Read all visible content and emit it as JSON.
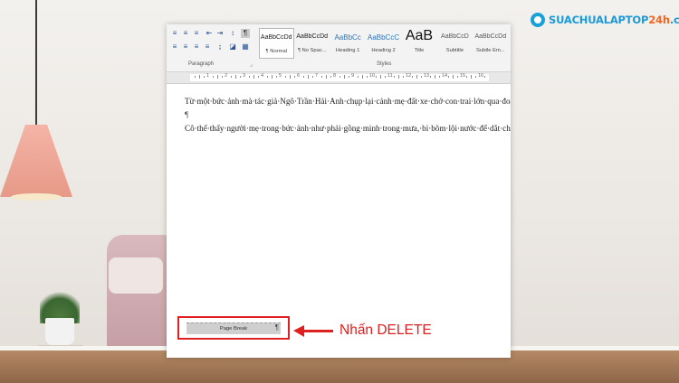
{
  "brand": {
    "logo_text_main": "SUACHUALAPTOP",
    "logo_text_accent": "24h",
    "logo_text_domain": ".com",
    "colors": {
      "primary": "#1a9ad6",
      "accent": "#f26522"
    }
  },
  "ribbon": {
    "paragraph_group_label": "Paragraph",
    "styles_group_label": "Styles",
    "styles": [
      {
        "sample": "AaBbCcDd",
        "name": "¶ Normal",
        "kind": "normal",
        "selected": true
      },
      {
        "sample": "AaBbCcDd",
        "name": "¶ No Spac...",
        "kind": "normal"
      },
      {
        "sample": "AaBbCc",
        "name": "Heading 1",
        "kind": "heading"
      },
      {
        "sample": "AaBbCcC",
        "name": "Heading 2",
        "kind": "heading"
      },
      {
        "sample": "AaB",
        "name": "Title",
        "kind": "title"
      },
      {
        "sample": "AaBbCcD",
        "name": "Subtitle",
        "kind": "sub"
      },
      {
        "sample": "AaBbCcDd",
        "name": "Subtle Em...",
        "kind": "sub"
      }
    ]
  },
  "ruler": {
    "numbers": [
      "1",
      "2",
      "3",
      "4",
      "5",
      "6",
      "7",
      "8",
      "9",
      "10",
      "11",
      "12",
      "13",
      "14",
      "15",
      "16"
    ]
  },
  "document": {
    "paragraph1": "Từ·một·bức·ảnh·mà·tác·giả·Ngô·Trần·Hải·Anh·chụp·lại·cảnh·mẹ·đất·xe·chở·con·trai·lớn·qua·đoạn·đường·nước·lụt·tại·Sài·Gòn,·nữ·sinh·lớp·11·Bùi·Như·Mai·đã·hoàn·thành·xuất·sắc·bài·cảm·nhận·về·về·tình·mẫu·tử·mà·cô·giáo·giao·cho.·Bài·văn·của·em·đạt·điểm·9·và·nhận·được·lời·khen·ngợi·của·cô.·Với·cách·viết·văn·chân·thực,·lời·văn·trong·sáng,·giàu·hình·ảnh·và·xúc·động,·Bùi·Như·Mai·đã·khiến·người·đọc·dễ·dàng·đồng·cảm·với·những·suy·nghĩ·của·em·về·tình·cảm·của·mẹ·đối·với·con·thật·bao·la·và·cao·thượng.¶",
    "empty_mark": "¶",
    "paragraph2": "Cô·thể·thấy·người·mẹ·trong·bức·ảnh·như·phải·gồng·mình·trong·mưa,·bì·bõm·lội·nước·để·dắt·chiếc·xe·đã·khó,·lại·còn·thêm·sức·nặng·của·một·cậu·con·trai·quý·tử·ngồi·bên·trên,·với·mong·muốn·sao·con·mình·vẫn·an·toàn·và·khô·ráo·đã·thực·sự·để·lại·ấn·tượng·sâu·sắc·đối·với·tác·giả.·Điều·đó,·khiến·tác·giả·trở·trăn,·suy·nghĩ·và·nhận·ra·chính·mình·trong·đó.·Chính·mình·vẫn·hàng·ngày·nhận·tình·yêu·thương·vô·điều·kiện·của·mẹ,·chính·mình·nhiều·khi·đã·làm·cho·mẹ·buồn.·Thầm·trách·bạn·trẻ·sức·dài·vai·rộng·ngồi·trên·xe·để·mẹ·dắt·bao·nhiêu,·tác·giả·lại·nghĩ·về·bản·thân·mình·phải·cố·gắng·nỗ·lực·để·làm·mẹ·vui·bầy·nhiêu.¶",
    "page_break_label": "Page Break",
    "page_break_mark": "¶"
  },
  "annotation": {
    "text": "Nhấn DELETE",
    "color": "#e02020"
  }
}
